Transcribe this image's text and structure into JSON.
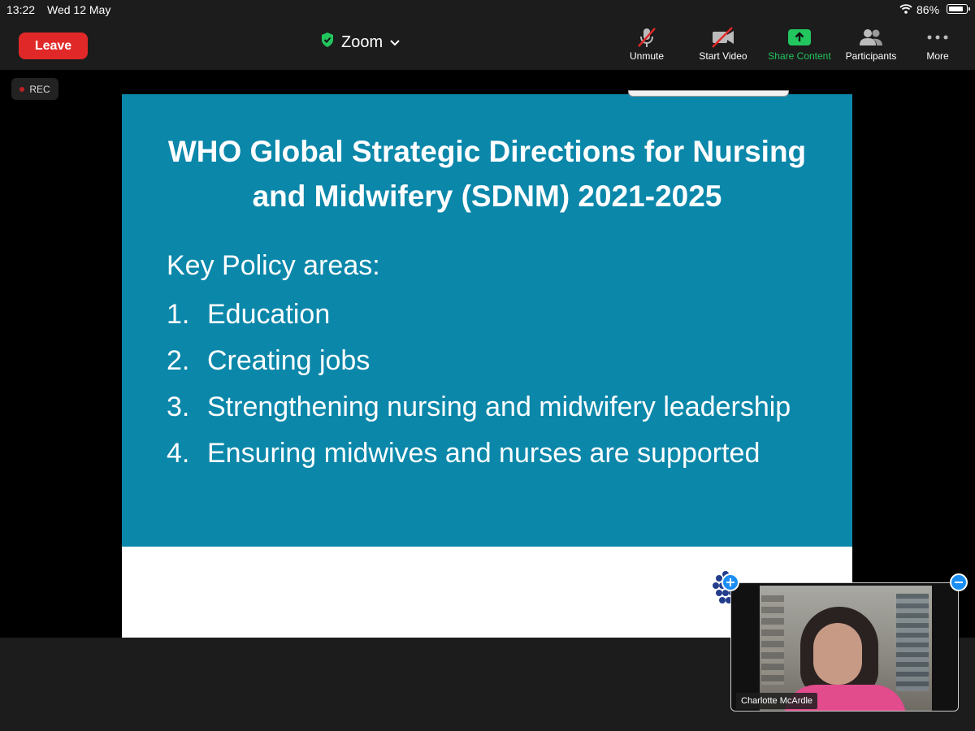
{
  "status_bar": {
    "time": "13:22",
    "date": "Wed 12 May",
    "battery_percent": "86%",
    "battery_level": 0.86
  },
  "toolbar": {
    "leave_label": "Leave",
    "app_title": "Zoom",
    "unmute_label": "Unmute",
    "start_video_label": "Start Video",
    "share_content_label": "Share Content",
    "participants_label": "Participants",
    "more_label": "More"
  },
  "recording": {
    "label": "REC"
  },
  "slide": {
    "title_line1": "WHO Global Strategic Directions for Nursing",
    "title_line2": "and Midwifery (SDNM) 2021-2025",
    "subtitle": "Key Policy areas:",
    "items": [
      {
        "num": "1.",
        "text": "Education"
      },
      {
        "num": "2.",
        "text": "Creating jobs"
      },
      {
        "num": "3.",
        "text": "Strengthening nursing and midwifery leadership"
      },
      {
        "num": "4.",
        "text": "Ensuring midwives and nurses are supported"
      }
    ]
  },
  "self_view": {
    "participant_name": "Charlotte McArdle"
  },
  "colors": {
    "slide_blue": "#0b87aa",
    "leave_red": "#e02828",
    "share_green": "#22c55e",
    "accent_blue": "#1a8ef5"
  }
}
